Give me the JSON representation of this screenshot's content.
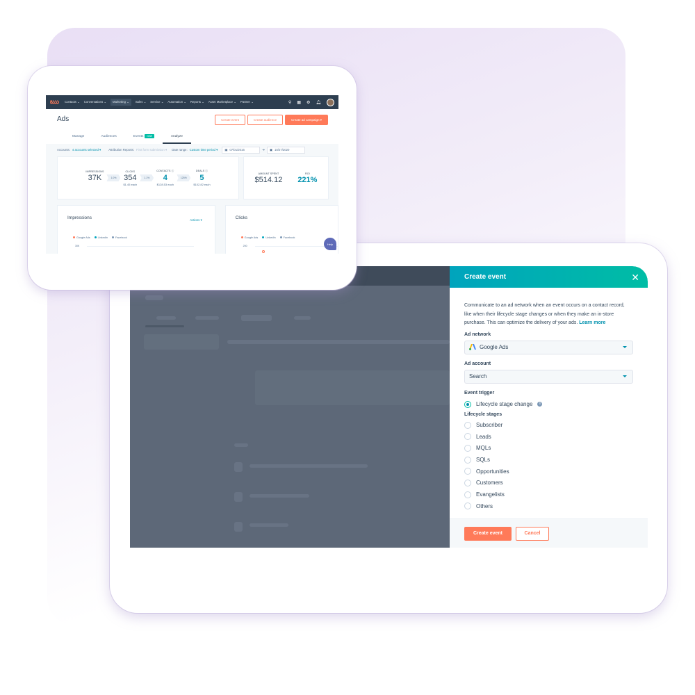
{
  "app": {
    "nav": {
      "items": [
        "Contacts",
        "Conversations",
        "Marketing",
        "Sales",
        "Service",
        "Automation",
        "Reports",
        "Asset Marketplace",
        "Partner"
      ],
      "active_item": "Marketing",
      "icons": [
        "search-icon",
        "marketplace-icon",
        "gear-icon",
        "bell-icon",
        "avatar"
      ]
    },
    "page_title": "Ads",
    "header_buttons": {
      "create_event": "Create event",
      "create_audience": "Create audience",
      "create_campaign": "Create ad campaign ▾"
    },
    "tabs": [
      {
        "label": "Manage"
      },
      {
        "label": "Audiences"
      },
      {
        "label": "Events",
        "badge": "NEW"
      },
      {
        "label": "Analyze",
        "active": true
      }
    ],
    "filters": {
      "accounts_label": "Accounts:",
      "accounts_value": "4 accounts selected ▾",
      "attribution_label": "Attribution Reports:",
      "attribution_value": "First form submission ▾",
      "date_range_label": "Date range:",
      "date_range_value": "Custom time period ▾",
      "start_date": "07/01/2016",
      "end_date": "10/27/2020",
      "date_arrow": "➜"
    },
    "funnel": {
      "impressions": {
        "label": "IMPRESSIONS",
        "value": "37K"
      },
      "rate1": "1.0%",
      "clicks": {
        "label": "CLICKS",
        "value": "354",
        "sub": "$1.45 each"
      },
      "rate2": "1.1%",
      "contacts": {
        "label": "CONTACTS ⓘ",
        "value": "4",
        "sub": "$128.53 each"
      },
      "rate3": "125%",
      "deals": {
        "label": "DEALS ⓘ",
        "value": "5",
        "sub": "$102.82 each"
      }
    },
    "roi": {
      "amount_label": "AMOUNT SPENT",
      "amount_value": "$514.12",
      "roi_label": "ROI",
      "roi_value": "221%"
    },
    "charts": [
      {
        "title": "Impressions",
        "actions": "Actions ▾",
        "legend": [
          "Google Ads",
          "LinkedIn",
          "Facebook"
        ],
        "y_tick": "30K"
      },
      {
        "title": "Clicks",
        "legend": [
          "Google Ads",
          "LinkedIn",
          "Facebook"
        ],
        "y_tick": "250"
      }
    ],
    "help_label": "Help"
  },
  "create_event_panel": {
    "title": "Create event",
    "description": "Communicate to an ad network when an event occurs on a contact record, like when their lifecycle stage changes or when they make an in-store purchase. This can optimize the delivery of your ads.",
    "learn_more": "Learn more",
    "ad_network_label": "Ad network",
    "ad_network_value": "Google Ads",
    "ad_account_label": "Ad account",
    "ad_account_value": "Search",
    "event_trigger_label": "Event trigger",
    "event_trigger_option": "Lifecycle stage change",
    "lifecycle_stages_label": "Lifecycle stages",
    "lifecycle_stages": [
      "Subscriber",
      "Leads",
      "MQLs",
      "SQLs",
      "Opportunities",
      "Customers",
      "Evangelists",
      "Others"
    ],
    "primary_button": "Create event",
    "cancel_button": "Cancel"
  },
  "colors": {
    "accent_orange": "#ff7a59",
    "accent_teal": "#00a4bd",
    "teal_link": "#0091ae",
    "nav_dark": "#2d3e50",
    "google_ads_dot": "#ff7a59",
    "linkedin_dot": "#00a4bd",
    "facebook_dot": "#7c98b6"
  }
}
